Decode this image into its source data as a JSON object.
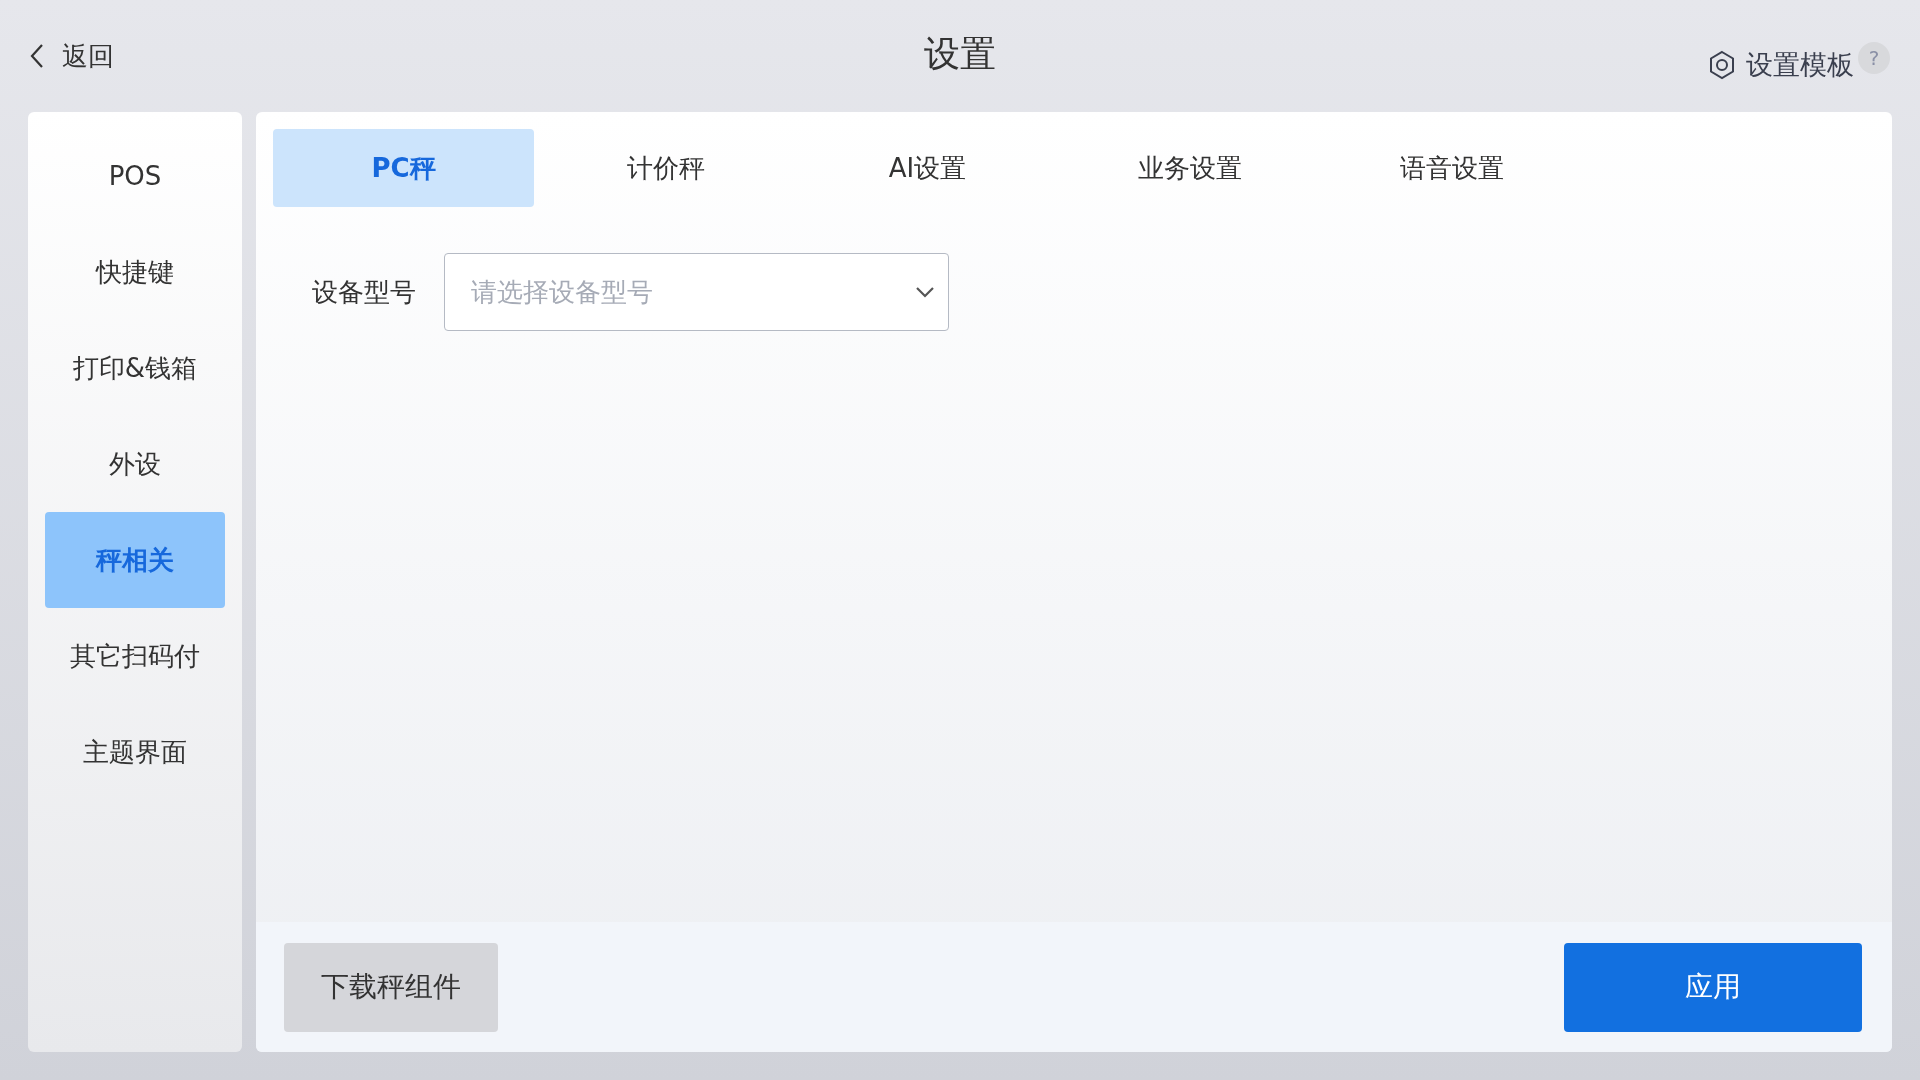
{
  "header": {
    "back": {
      "label": "返回"
    },
    "title": "设置",
    "template": {
      "label": "设置模板",
      "help": "?"
    }
  },
  "sidebar": {
    "items": [
      {
        "label": "POS",
        "selected": false
      },
      {
        "label": "快捷键",
        "selected": false
      },
      {
        "label": "打印&钱箱",
        "selected": false
      },
      {
        "label": "外设",
        "selected": false
      },
      {
        "label": "秤相关",
        "selected": true
      },
      {
        "label": "其它扫码付",
        "selected": false
      },
      {
        "label": "主题界面",
        "selected": false
      }
    ]
  },
  "tabs": [
    {
      "label": "PC秤",
      "selected": true
    },
    {
      "label": "计价秤",
      "selected": false
    },
    {
      "label": "AI设置",
      "selected": false
    },
    {
      "label": "业务设置",
      "selected": false
    },
    {
      "label": "语音设置",
      "selected": false
    }
  ],
  "form": {
    "label": "设备型号",
    "select": {
      "placeholder": "请选择设备型号"
    }
  },
  "footer": {
    "download": "下载秤组件",
    "apply": "应用"
  }
}
